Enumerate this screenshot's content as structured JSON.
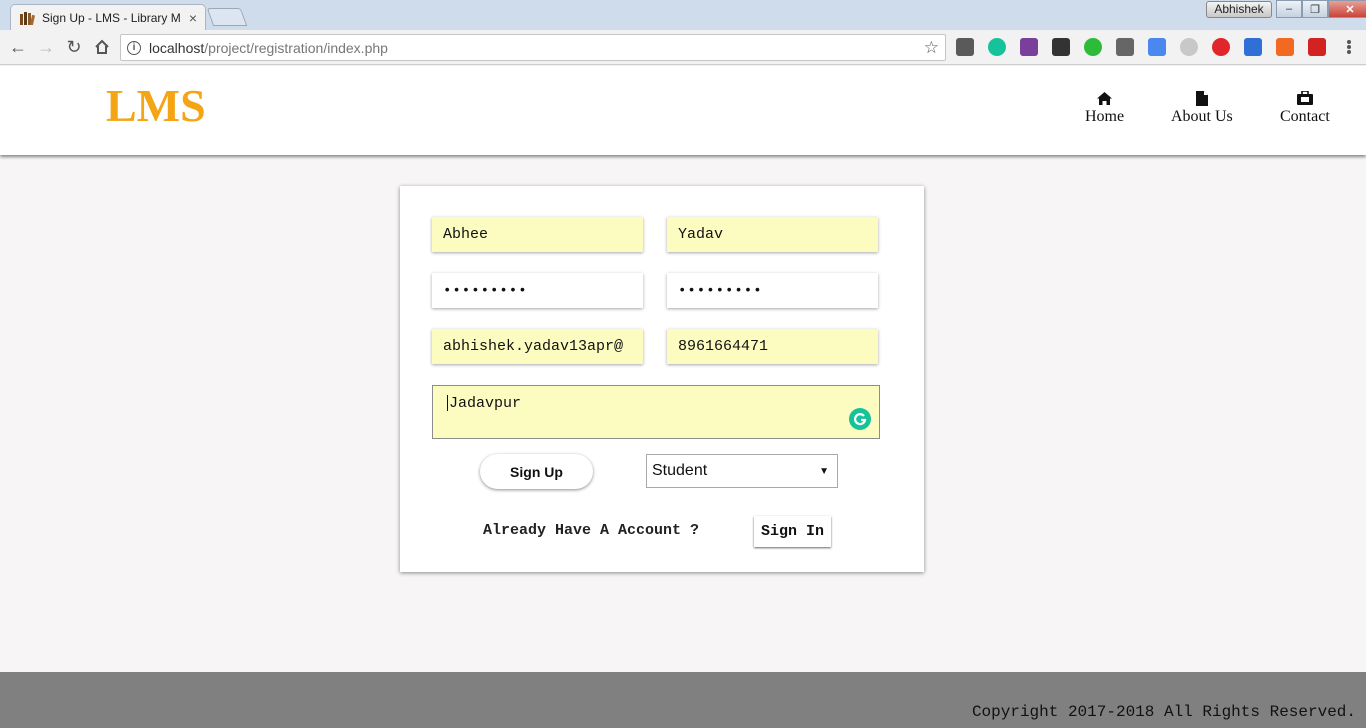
{
  "browser": {
    "tab_title": "Sign Up - LMS - Library M",
    "profile_name": "Abhishek",
    "url_host": "localhost",
    "url_path": "/project/registration/index.php",
    "extensions": [
      {
        "name": "lightbulb-ext",
        "color": "#5a5a5a"
      },
      {
        "name": "grammarly-ext",
        "color": "#15c39a"
      },
      {
        "name": "color-picker-ext",
        "color": "#7a3f9a"
      },
      {
        "name": "qr-code-ext",
        "color": "#333333"
      },
      {
        "name": "check-ext",
        "color": "#2dbb3a"
      },
      {
        "name": "trash-ext",
        "color": "#666666"
      },
      {
        "name": "translate-ext",
        "color": "#4a87ee"
      },
      {
        "name": "disabled-ext",
        "color": "#c8c8c8"
      },
      {
        "name": "opera-ext",
        "color": "#e0262b"
      },
      {
        "name": "shield-ext",
        "color": "#2f6fd6"
      },
      {
        "name": "fish-ext",
        "color": "#f26a22"
      },
      {
        "name": "pdf-ext",
        "color": "#d32222"
      }
    ]
  },
  "header": {
    "logo": "LMS",
    "nav": [
      {
        "label": "Home",
        "icon": "home-icon"
      },
      {
        "label": "About Us",
        "icon": "document-icon"
      },
      {
        "label": "Contact",
        "icon": "briefcase-icon"
      }
    ]
  },
  "form": {
    "first_name": "Abhee",
    "last_name": "Yadav",
    "password": "•••••••••",
    "confirm_password": "•••••••••",
    "email": "abhishek.yadav13apr@",
    "phone": "8961664471",
    "address": "Jadavpur",
    "signup_label": "Sign Up",
    "role_selected": "Student",
    "already_text": "Already Have A Account ?",
    "signin_label": "Sign In"
  },
  "footer": {
    "copyright": "Copyright 2017-2018 All Rights Reserved."
  }
}
